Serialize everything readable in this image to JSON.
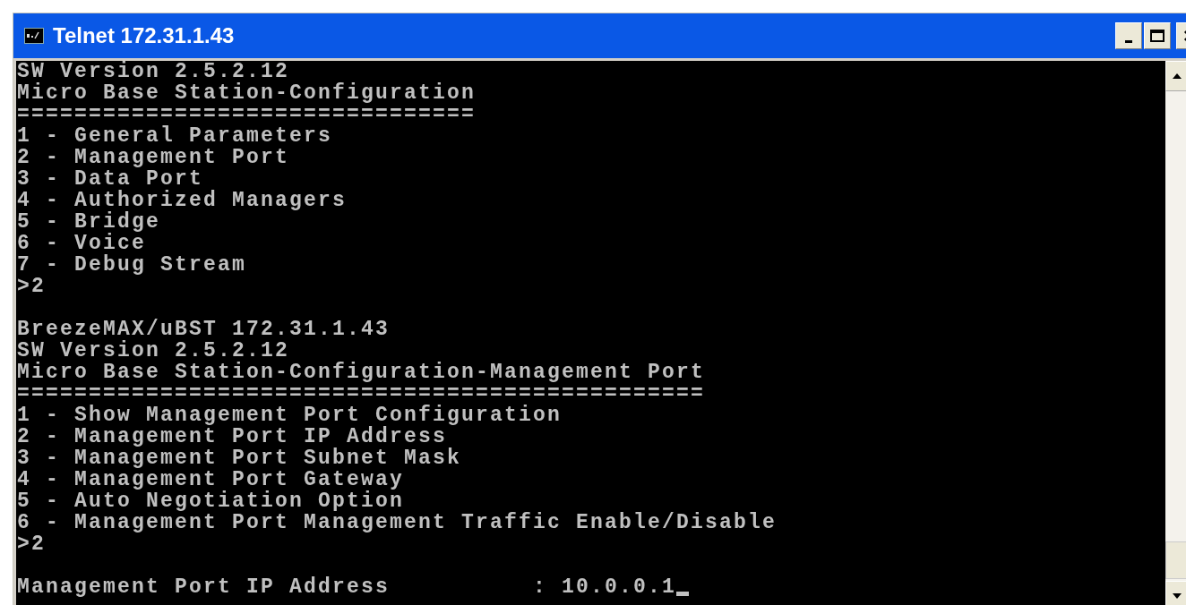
{
  "window": {
    "title": "Telnet 172.31.1.43"
  },
  "terminal": {
    "lines": [
      {
        "kind": "text",
        "text": "SW Version 2.5.2.12"
      },
      {
        "kind": "text",
        "text": "Micro Base Station-Configuration"
      },
      {
        "kind": "text",
        "text": "================================"
      },
      {
        "kind": "text",
        "text": "1 - General Parameters"
      },
      {
        "kind": "text",
        "text": "2 - Management Port"
      },
      {
        "kind": "text",
        "text": "3 - Data Port"
      },
      {
        "kind": "text",
        "text": "4 - Authorized Managers"
      },
      {
        "kind": "text",
        "text": "5 - Bridge"
      },
      {
        "kind": "text",
        "text": "6 - Voice"
      },
      {
        "kind": "text",
        "text": "7 - Debug Stream"
      },
      {
        "kind": "text",
        "text": ">2"
      },
      {
        "kind": "blank"
      },
      {
        "kind": "text",
        "text": "BreezeMAX/uBST 172.31.1.43"
      },
      {
        "kind": "text",
        "text": "SW Version 2.5.2.12"
      },
      {
        "kind": "text",
        "text": "Micro Base Station-Configuration-Management Port"
      },
      {
        "kind": "text",
        "text": "================================================"
      },
      {
        "kind": "text",
        "text": "1 - Show Management Port Configuration"
      },
      {
        "kind": "text",
        "text": "2 - Management Port IP Address"
      },
      {
        "kind": "text",
        "text": "3 - Management Port Subnet Mask"
      },
      {
        "kind": "text",
        "text": "4 - Management Port Gateway"
      },
      {
        "kind": "text",
        "text": "5 - Auto Negotiation Option"
      },
      {
        "kind": "text",
        "text": "6 - Management Port Management Traffic Enable/Disable"
      },
      {
        "kind": "text",
        "text": ">2"
      },
      {
        "kind": "blank"
      },
      {
        "kind": "input",
        "text": "Management Port IP Address          : 10.0.0.1"
      }
    ]
  }
}
